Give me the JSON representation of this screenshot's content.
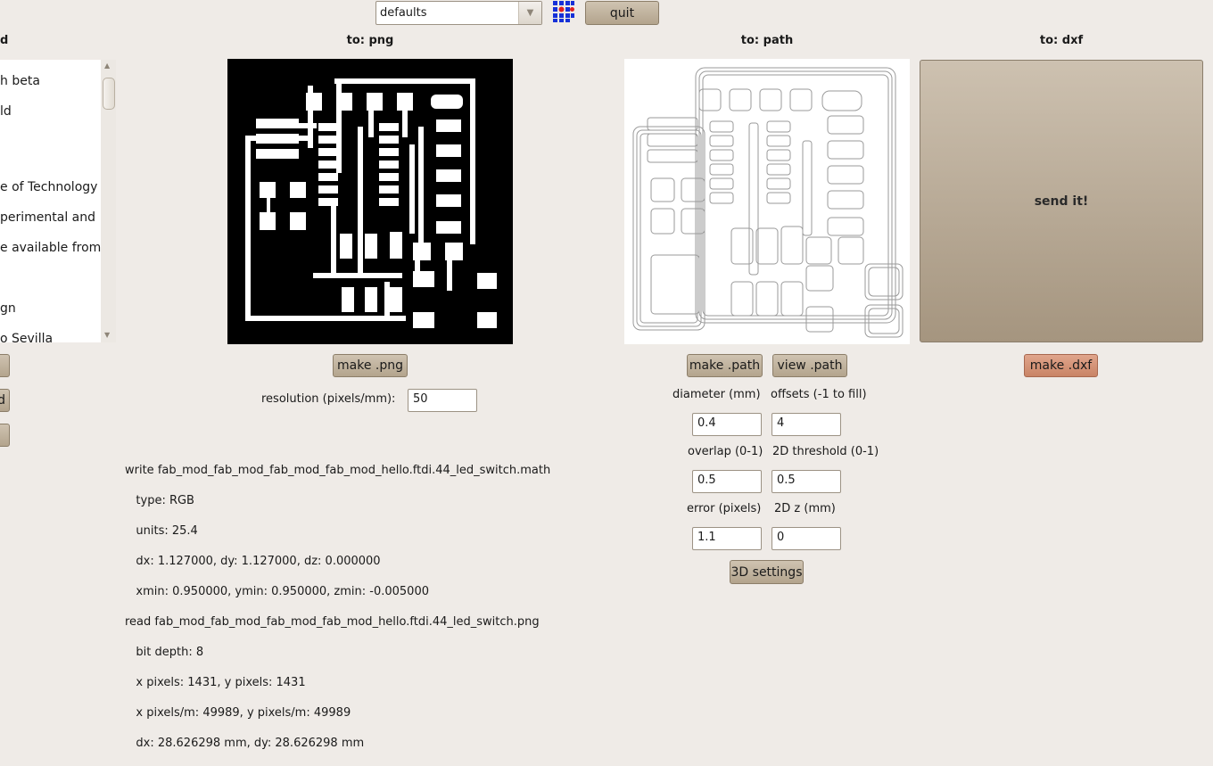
{
  "toolbar": {
    "profile_select_value": "defaults",
    "quit_label": "quit"
  },
  "left_panel": {
    "heading_partial": "d",
    "list_items": [
      "h beta",
      "ld",
      "e of Technology",
      "perimental and",
      "e available from",
      "gn",
      "o Sevilla"
    ],
    "button_partials": [
      "",
      "d",
      ""
    ]
  },
  "png_panel": {
    "heading": "to: png",
    "make_label": "make .png",
    "resolution_label": "resolution (pixels/mm):",
    "resolution_value": "50"
  },
  "path_panel": {
    "heading": "to: path",
    "make_label": "make .path",
    "view_label": "view .path",
    "diameter_label": "diameter (mm)",
    "diameter_value": "0.4",
    "offsets_label": "offsets (-1 to fill)",
    "offsets_value": "4",
    "overlap_label": "overlap (0-1)",
    "overlap_value": "0.5",
    "threshold_label": "2D threshold (0-1)",
    "threshold_value": "0.5",
    "error_label": "error (pixels)",
    "error_value": "1.1",
    "z_label": "2D z (mm)",
    "z_value": "0",
    "settings3d_label": "3D settings"
  },
  "dxf_panel": {
    "heading": "to: dxf",
    "send_label": "send it!",
    "make_label": "make .dxf"
  },
  "log_lines": [
    "write fab_mod_fab_mod_fab_mod_fab_mod_hello.ftdi.44_led_switch.math",
    "   type: RGB",
    "   units: 25.4",
    "   dx: 1.127000, dy: 1.127000, dz: 0.000000",
    "   xmin: 0.950000, ymin: 0.950000, zmin: -0.005000",
    "read fab_mod_fab_mod_fab_mod_fab_mod_hello.ftdi.44_led_switch.png",
    "   bit depth: 8",
    "   x pixels: 1431, y pixels: 1431",
    "   x pixels/m: 49989, y pixels/m: 49989",
    "   dx: 28.626298 mm, dy: 28.626298 mm"
  ],
  "icons": {
    "logo": "fab-grid-logo-icon",
    "dropdown": "chevron-down-icon",
    "scroll_up": "scroll-up-arrow-icon",
    "scroll_down": "scroll-down-arrow-icon"
  }
}
